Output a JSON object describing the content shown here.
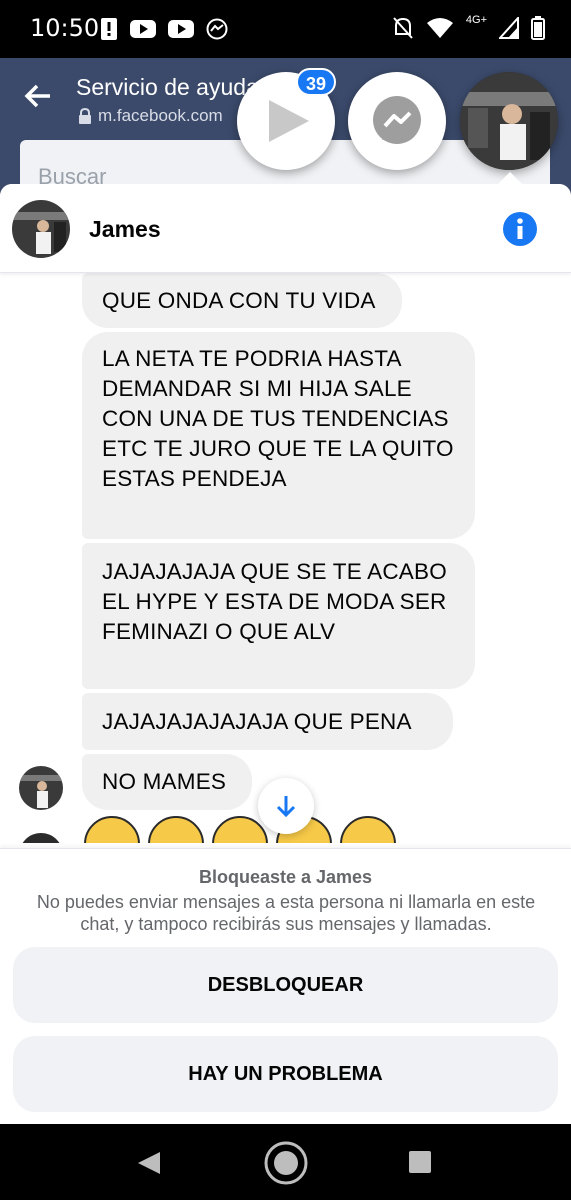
{
  "status_bar": {
    "time": "10:50",
    "network": "4G+"
  },
  "browser": {
    "page_title": "Servicio de ayuda",
    "url": "m.facebook.com",
    "search_placeholder": "Buscar"
  },
  "chat_heads": {
    "video_badge": "39"
  },
  "chat": {
    "contact_name": "James",
    "messages": [
      "QUE ONDA CON TU VIDA",
      "LA NETA TE PODRIA HASTA DEMANDAR SI MI HIJA SALE CON UNA DE TUS TENDENCIAS ETC TE JURO QUE TE  LA QUITO ESTAS PENDEJA",
      "JAJAJAJAJA QUE SE TE ACABO EL HYPE Y ESTA DE MODA SER FEMINAZI O QUE ALV",
      "JAJAJAJAJAJAJA QUE PENA",
      "NO MAMES"
    ]
  },
  "blocked": {
    "title": "Bloqueaste a James",
    "description": "No puedes enviar mensajes a esta persona ni llamarla en este chat, y tampoco recibirás sus mensajes y llamadas.",
    "unblock_label": "DESBLOQUEAR",
    "problem_label": "HAY UN PROBLEMA"
  },
  "colors": {
    "accent": "#1877f2",
    "bubble": "#f0f0f0",
    "button": "#f0f2f5"
  }
}
